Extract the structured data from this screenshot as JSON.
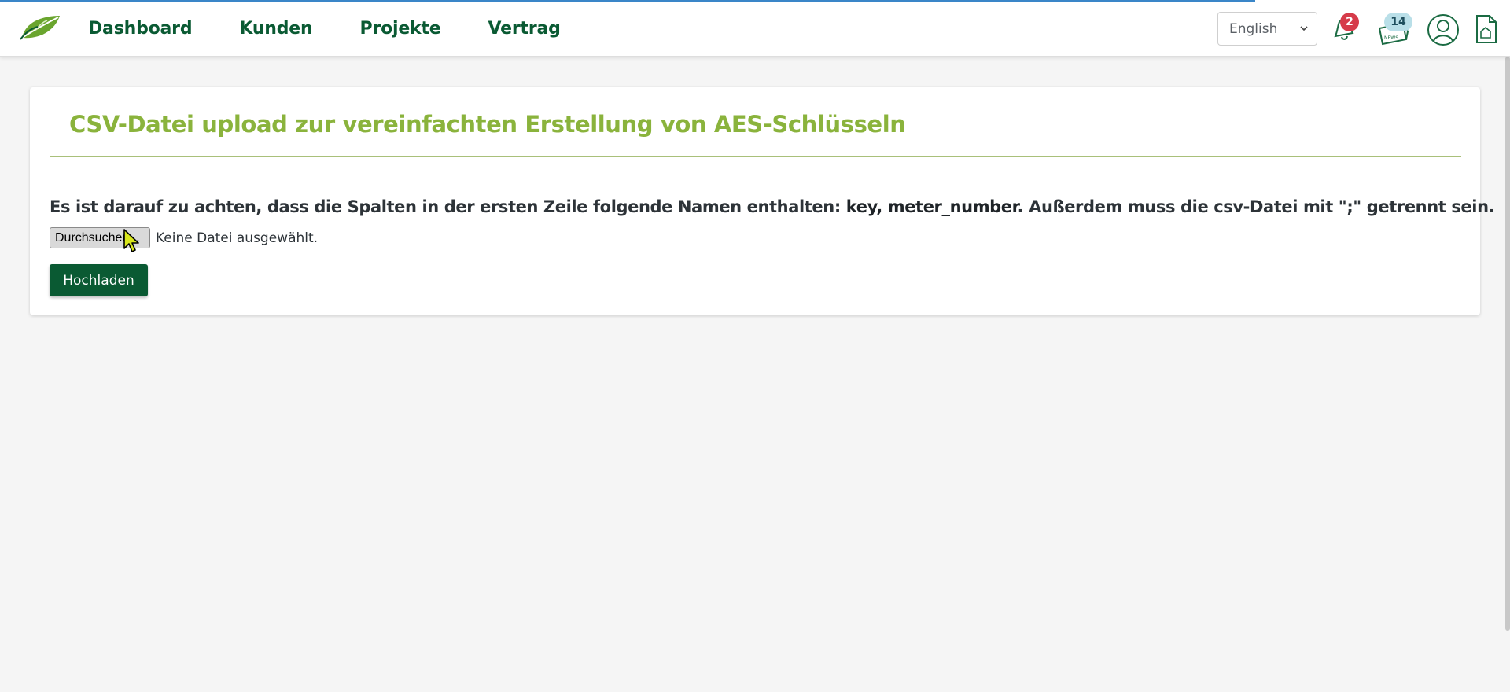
{
  "nav": {
    "items": [
      "Dashboard",
      "Kunden",
      "Projekte",
      "Vertrag"
    ]
  },
  "header": {
    "language": "English",
    "notifications_count": "2",
    "news_count": "14",
    "news_label": "NEWS"
  },
  "card": {
    "title": "CSV-Datei upload zur vereinfachten Erstellung von AES-Schlüsseln",
    "instruction_prefix": "Es ist darauf zu achten, dass die Spalten in der ersten Zeile folgende Namen enthalten: ",
    "instruction_fields": "key, meter_number",
    "instruction_suffix": ". Außerdem muss die csv-Datei mit \";\" getrennt sein.",
    "file_button_label": "Durchsuchen...",
    "file_status": "Keine Datei ausgewählt.",
    "upload_label": "Hochladen"
  },
  "colors": {
    "brand_dark_green": "#0a5a33",
    "title_green": "#8ab33c",
    "badge_red": "#d63b4a",
    "badge_news": "#b9dfe8"
  },
  "icons": [
    "leaf-logo-icon",
    "chevron-down-icon",
    "bell-icon",
    "news-icon",
    "user-icon",
    "document-icon",
    "cursor-icon"
  ]
}
